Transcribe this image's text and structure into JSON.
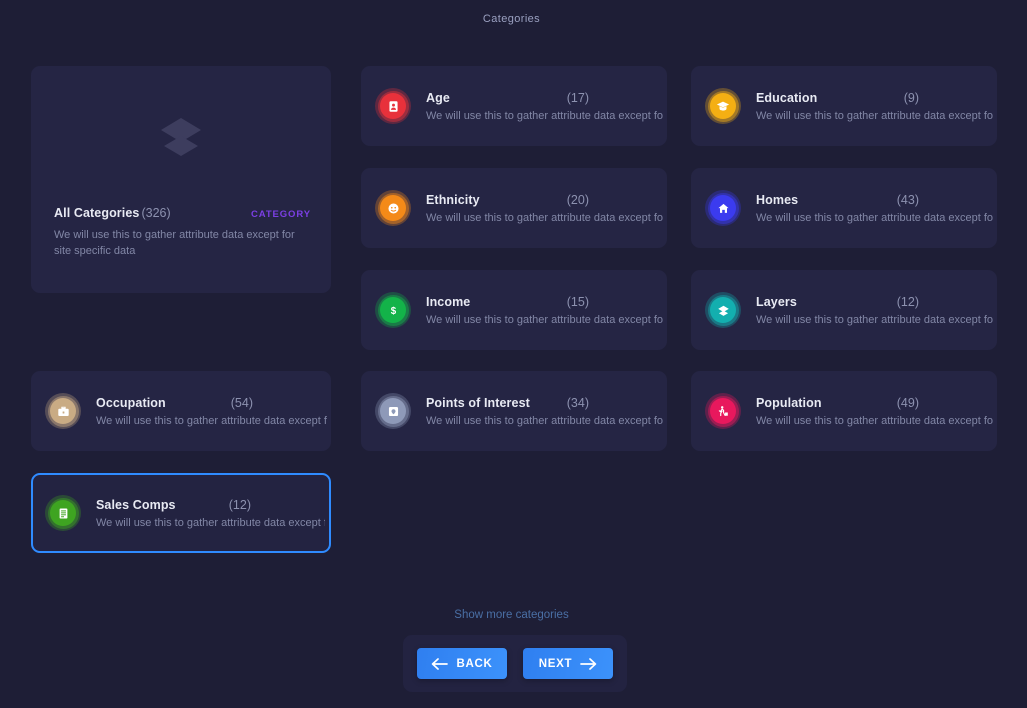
{
  "header": {
    "title": "Categories"
  },
  "hero": {
    "icon": "layers-icon",
    "name": "All Categories",
    "count": "(326)",
    "badge": "CATEGORY",
    "description": "We will use this to gather attribute data except for site specific data",
    "accent": "#7b3fe4"
  },
  "categories": [
    {
      "name": "Age",
      "count": "(17)",
      "description": "We will use this to gather attribute data except for",
      "icon": "id-badge-icon",
      "color": "#e8323c",
      "selected": false
    },
    {
      "name": "Education",
      "count": "(9)",
      "description": "We will use this to gather attribute data except for",
      "icon": "graduation-cap-icon",
      "color": "#f5b014",
      "selected": false
    },
    {
      "name": "Ethnicity",
      "count": "(20)",
      "description": "We will use this to gather attribute data except for",
      "icon": "face-icon",
      "color": "#f58a19",
      "selected": false
    },
    {
      "name": "Homes",
      "count": "(43)",
      "description": "We will use this to gather attribute data except for",
      "icon": "home-icon",
      "color": "#3b3bf0",
      "selected": false
    },
    {
      "name": "Income",
      "count": "(15)",
      "description": "We will use this to gather attribute data except for",
      "icon": "dollar-icon",
      "color": "#14b34a",
      "selected": false
    },
    {
      "name": "Layers",
      "count": "(12)",
      "description": "We will use this to gather attribute data except for",
      "icon": "layers-icon",
      "color": "#13b0b0",
      "selected": false
    },
    {
      "name": "Occupation",
      "count": "(54)",
      "description": "We will use this to gather attribute data except for",
      "icon": "briefcase-icon",
      "color": "#c9ab84",
      "selected": false
    },
    {
      "name": "Points of Interest",
      "count": "(34)",
      "description": "We will use this to gather attribute data except for",
      "icon": "map-marker-icon",
      "color": "#8e9ab8",
      "selected": false
    },
    {
      "name": "Population",
      "count": "(49)",
      "description": "We will use this to gather attribute data except for",
      "icon": "walking-person-icon",
      "color": "#e8195e",
      "selected": false
    },
    {
      "name": "Sales Comps",
      "count": "(12)",
      "description": "We will use this to gather attribute data except for",
      "icon": "receipt-icon",
      "color": "#3fa521",
      "selected": true
    }
  ],
  "footer": {
    "show_more_label": "Show more categories",
    "back_label": "BACK",
    "next_label": "NEXT",
    "button_color": "#2f7ff0",
    "link_color": "#4a6fa5"
  }
}
